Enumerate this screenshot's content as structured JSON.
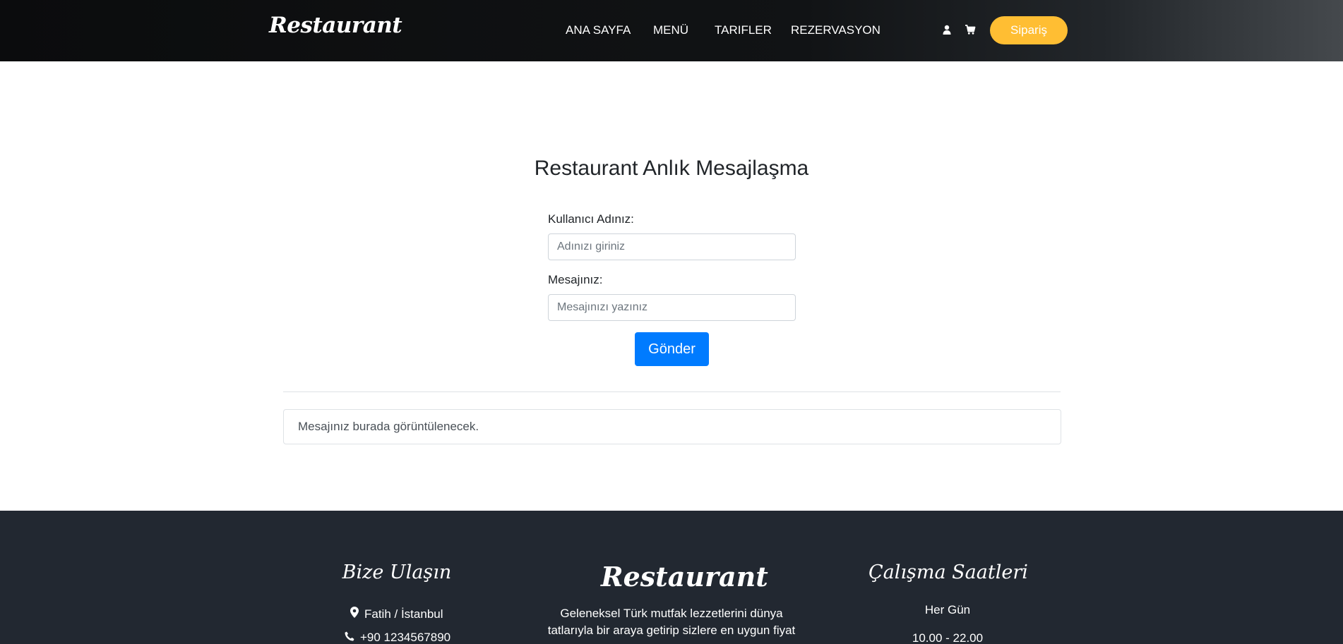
{
  "header": {
    "brand": "Restaurant",
    "nav": [
      "ANA SAYFA",
      "MENÜ",
      "TARIFLER",
      "REZERVASYON"
    ],
    "icons": [
      "user-icon",
      "cart-icon"
    ],
    "order_label": "Sipariş"
  },
  "main": {
    "title": "Restaurant Anlık Mesajlaşma",
    "username_label": "Kullanıcı Adınız:",
    "username_placeholder": "Adınızı giriniz",
    "message_label": "Mesajınız:",
    "message_placeholder": "Mesajınızı yazınız",
    "send_label": "Gönder",
    "output_text": "Mesajınız burada görüntülenecek."
  },
  "footer": {
    "contact_title": "Bize Ulaşın",
    "location": "Fatih / İstanbul",
    "phone": "+90 1234567890",
    "brand": "Restaurant",
    "description": "Geleneksel Türk mutfak lezzetlerini dünya tatlarıyla bir araya getirip sizlere en uygun fiyat",
    "hours_title": "Çalışma Saatleri",
    "hours_days": "Her Gün",
    "hours_time": "10.00 - 22.00"
  },
  "colors": {
    "accent": "#ffbe33",
    "primary_button": "#007bff",
    "footer_bg": "#222831"
  }
}
